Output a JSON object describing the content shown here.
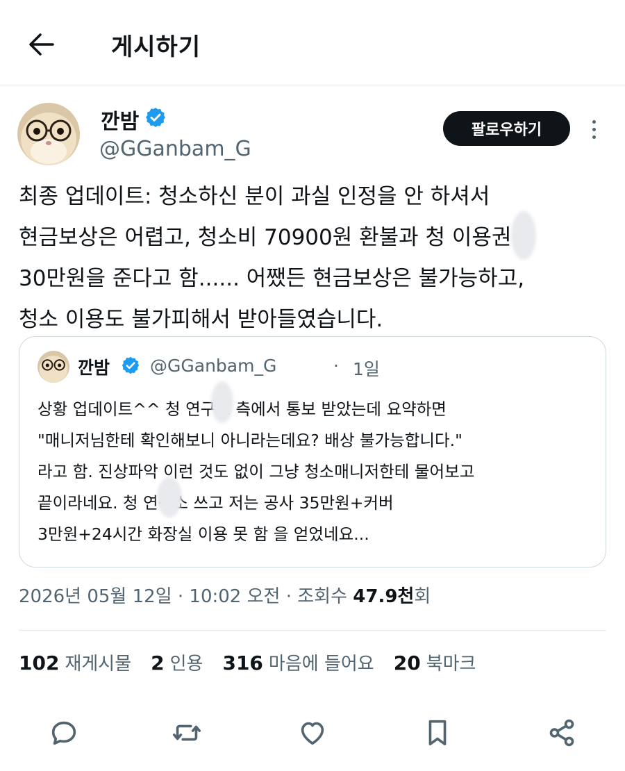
{
  "header": {
    "title": "게시하기",
    "back_icon": "arrow-left-icon"
  },
  "author": {
    "display_name": "깐밤",
    "handle": "@GGanbam_G",
    "verified": true,
    "follow_label": "팔로우하기"
  },
  "tweet": {
    "lines": [
      "최종 업데이트: 청소하신 분이 과실 인정을 안 하셔서",
      "현금보상은 어렵고, 청소비 70900원 환불과 청   이용권",
      "30만원을 준다고 함...... 어쨌든 현금보상은 불가능하고,",
      "청소 이용도 불가피해서 받아들였습니다."
    ]
  },
  "quote": {
    "display_name": "깐밤",
    "handle": "@GGanbam_G",
    "separator": "·",
    "time": "1일",
    "lines": [
      "상황 업데이트^^ 청  연구소 측에서 통보 받았는데 요약하면",
      "\"매니저님한테 확인해보니 아니라는데요? 배상 불가능합니다.\"",
      "라고 함. 진상파악 이런 것도 없이 그냥 청소매니저한테 물어보고",
      "끝이라네요. 청  연구소 쓰고 저는 공사 35만원+커버",
      "3만원+24시간 화장실 이용 못 함 을 얻었네요..."
    ]
  },
  "meta": {
    "timestamp": "2026년 05월 12일 · 10:02 오전 · 조회수",
    "views_value": "47.9천",
    "views_suffix": "회"
  },
  "stats": [
    {
      "value": "102",
      "label": "재게시물"
    },
    {
      "value": "2",
      "label": "인용"
    },
    {
      "value": "316",
      "label": "마음에 들어요"
    },
    {
      "value": "20",
      "label": "북마크"
    }
  ],
  "actions": [
    "reply-icon",
    "retweet-icon",
    "like-icon",
    "bookmark-icon",
    "share-icon"
  ],
  "colors": {
    "text": "#0f1419",
    "secondary": "#536471",
    "verified": "#1d9bf0",
    "border": "#cfd9de"
  }
}
